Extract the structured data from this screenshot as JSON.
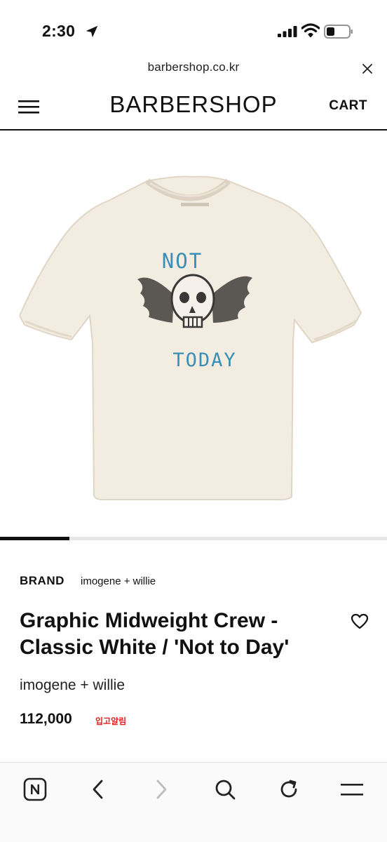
{
  "status": {
    "time": "2:30"
  },
  "url_bar": {
    "url": "barbershop.co.kr"
  },
  "header": {
    "logo": "BARBERSHOP",
    "cart_label": "CART"
  },
  "product_image": {
    "graphic_text_top": "NOT",
    "graphic_text_bottom": "TODAY"
  },
  "carousel": {
    "progress": 0.18
  },
  "product": {
    "brand_label": "BRAND",
    "brand_name": "imogene + willie",
    "title": "Graphic Midweight Crew - Classic White / 'Not to Day'",
    "brand_line": "imogene + willie",
    "price": "112,000",
    "restock_label": "입고알림"
  },
  "colors": {
    "accent_red": "#e02020",
    "shirt": "#f2ece1",
    "print_blue": "#3a8fb7"
  },
  "toolbar": {
    "items": [
      "naver-icon",
      "back-icon",
      "forward-icon",
      "search-icon",
      "reload-icon",
      "menu-icon"
    ]
  }
}
